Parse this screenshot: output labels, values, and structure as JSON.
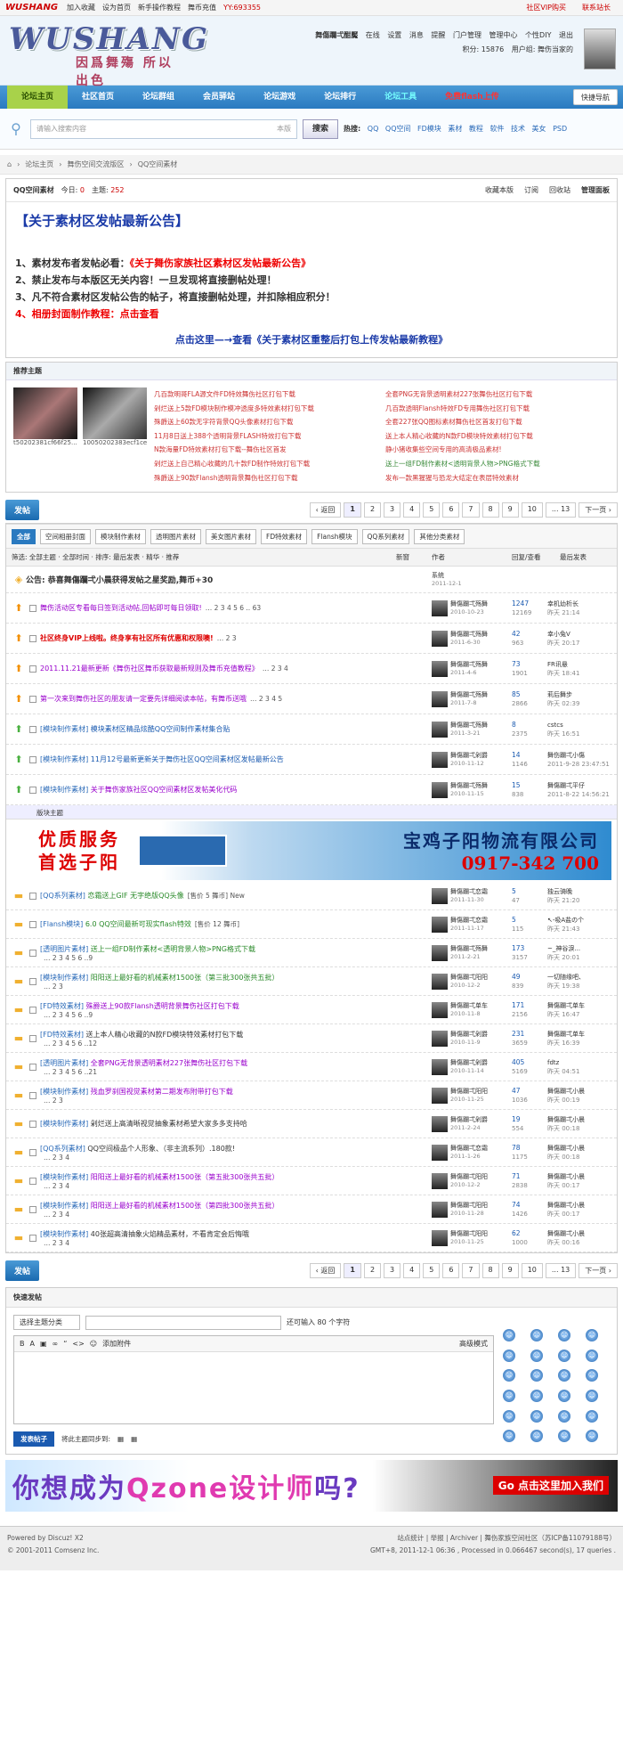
{
  "topbar": {
    "logo": "WUSHANG",
    "links": [
      "加入收藏",
      "设为首页",
      "新手操作教程",
      "舞币充值",
      "YY:693355"
    ],
    "right": [
      "社区VIP购买",
      "联系站长"
    ]
  },
  "header": {
    "brand": "WUSHANG",
    "slogan": "因爲舞殤 所以出色",
    "user_name": "舞傷躝弌酣魘",
    "user_links": [
      "在线",
      "设置",
      "消息",
      "提醒",
      "门户管理",
      "管理中心",
      "个性DIY",
      "退出"
    ],
    "credit": "积分: 15876",
    "usergroup": "用户组: 舞伤当家的"
  },
  "nav": {
    "items": [
      "论坛主页",
      "社区首页",
      "论坛群组",
      "会员驿站",
      "论坛游戏",
      "论坛排行",
      "论坛工具",
      "免费flash上传"
    ],
    "quick": "快捷导航"
  },
  "search": {
    "placeholder": "请输入搜索内容",
    "scope": "本版",
    "button": "搜索",
    "hot_label": "热搜:",
    "hot": [
      "QQ",
      "QQ空间",
      "FD模块",
      "素材",
      "教程",
      "软件",
      "技术",
      "美女",
      "PSD"
    ]
  },
  "crumb": [
    "论坛主页",
    "舞伤空间交流版区",
    "QQ空间素材"
  ],
  "forum": {
    "name": "QQ空间素材",
    "today_label": "今日:",
    "today": "0",
    "topics_label": "主题:",
    "topics": "252",
    "ops": [
      "收藏本版",
      "订阅",
      "回收站",
      "管理面板"
    ]
  },
  "announce": {
    "title": "【关于素材区发帖最新公告】",
    "l1a": "1、素材发布者发帖必看：",
    "l1b": "《关于舞伤家族社区素材区发帖最新公告》",
    "l2": "2、禁止发布与本版区无关内容！一旦发现将直接删帖处理！",
    "l3": "3、凡不符合素材区发帖公告的帖子，将直接删帖处理，并扣除相应积分！",
    "l4a": "4、相册封面制作教程：",
    "l4b": "点击查看",
    "link": "点击这里—→查看《关于素材区重整后打包上传发帖最新教程》"
  },
  "hot": {
    "title": "推荐主题",
    "captions": [
      "t50202381cf66f25...",
      "10050202383ecf1ce"
    ],
    "col1": [
      "几百款明哥FLA源文件FD特效舞伤社区打包下载",
      "剁烂送上5款FD模块制作模冲透度多特效素材打包下载",
      "殊爵送上60款无字符背景QQ头像素材打包下载",
      "11月8日送上388个透明背景FLASH特效打包下载",
      "N款海量FD特效素材打包下载--舞伤社区首发",
      "剁烂送上自己精心收藏的几十款FD制作特效打包下载",
      "殊爵送上90款Flansh透明背景舞伤社区打包下载"
    ],
    "col2": [
      "全套PNG无背景透明素材227张舞伤社区打包下载",
      "几百款透明Flansh特效FD专用舞伤社区打包下载",
      "全套227张QQ图标素材舞伤社区首发打包下载",
      "送上本人精心收藏的N款FD模块特效素材打包下载",
      "静小猪收集些空间专用的高清极品素材!",
      "送上一组FD制作素材<透明背景人物>PNG格式下载",
      "发布一款黑猩猩与恐龙大结定在表层特效素材"
    ]
  },
  "pager": {
    "post": "发帖",
    "prev": "返回",
    "pages": [
      "1",
      "2",
      "3",
      "4",
      "5",
      "6",
      "7",
      "8",
      "9",
      "10",
      "... 13"
    ],
    "next": "下一页"
  },
  "types": [
    "全部",
    "空间相册封面",
    "模块制作素材",
    "透明图片素材",
    "美女图片素材",
    "FD特效素材",
    "Flansh模块",
    "QQ系列素材",
    "其他分类素材"
  ],
  "filter": {
    "left": "筛选: 全部主题 · 全部时间 · 排序: 最后发表 · 精华 · 推荐",
    "new": "新窗",
    "author": "作者",
    "replies": "回复/查看",
    "last": "最后发表"
  },
  "threads_top": [
    {
      "ic": "sys",
      "subj": "公告: 恭喜舞傷躝弌小晨获得发帖之星奖励,舞币+30",
      "cls": "",
      "author": "系统",
      "date": "2011-12-1",
      "r": "",
      "v": "",
      "la": "",
      "ld": ""
    },
    {
      "ic": "up",
      "subj": "舞伤活动区专看每日签到活动帖,回帖即可每日领取!",
      "pages": "2 3 4 5 6 .. 63",
      "cls": "purple",
      "author": "舞傷躝弌殇舞",
      "date": "2010-10-23",
      "r": "1247",
      "v": "12169",
      "la": "幸机幼析长",
      "ld": "昨天 21:14"
    },
    {
      "ic": "up",
      "subj": "社区终身VIP上线啦。终身享有社区所有优惠和权限噢!",
      "pages": "2 3",
      "cls": "red",
      "author": "舞傷躝弌殇舞",
      "date": "2011-6-30",
      "r": "42",
      "v": "963",
      "la": "幸小兔V",
      "ld": "昨天 20:17"
    },
    {
      "ic": "up",
      "subj": "2011.11.21最新更新《舞伤社区舞币获取最新规则及舞币充值教程》",
      "pages": "2 3 4",
      "cls": "purple",
      "author": "舞傷躝弌殇舞",
      "date": "2011-4-6",
      "r": "73",
      "v": "1901",
      "la": "FR讯悬",
      "ld": "昨天 18:41"
    },
    {
      "ic": "up",
      "subj": "第一次来到舞伤社区的朋友请一定要先详细阅读本帖，有舞币送哦",
      "pages": "2 3 4 5",
      "cls": "purple",
      "author": "舞傷躝弌殇舞",
      "date": "2011-7-8",
      "r": "85",
      "v": "2866",
      "la": "莉后舞步",
      "ld": "昨天 02:39"
    },
    {
      "ic": "gr",
      "type": "[模块制作素材]",
      "subj": "模块素材区精品炫酷QQ空间制作素材集合贴",
      "cls": "blue",
      "author": "舞傷躝弌殇舞",
      "date": "2011-3-21",
      "r": "8",
      "v": "2375",
      "la": "cstcs",
      "ld": "昨天 16:51"
    },
    {
      "ic": "gr",
      "type": "[模块制作素材]",
      "subj": "11月12号最新更新关于舞伤社区QQ空间素材区发帖最新公告",
      "cls": "blue",
      "author": "舞傷躝弌剁爵",
      "date": "2010-11-12",
      "r": "14",
      "v": "1146",
      "la": "舞伤躝弌小傷",
      "ld": "2011-9-28 23:47:51"
    },
    {
      "ic": "gr",
      "type": "[模块制作素材]",
      "subj": "关于舞伤家族社区QQ空间素材区发帖美化代码",
      "cls": "purple",
      "author": "舞傷躝弌殇舞",
      "date": "2010-11-15",
      "r": "15",
      "v": "838",
      "la": "舞傷躝弌平仔",
      "ld": "2011-8-22 14:56:21"
    }
  ],
  "sep": "版块主题",
  "banner1": {
    "l1": "优质服务",
    "l2": "首选子阳",
    "company": "宝鸡子阳物流有限公司",
    "phone": "0917-342 700"
  },
  "threads": [
    {
      "type": "[QQ系列素材]",
      "subj": "恋霜送上GIF 无字绝版QQ头像",
      "extra": "[售价 5 舞币] New",
      "cls": "green",
      "author": "舞傷躝弌恋霜",
      "date": "2011-11-30",
      "r": "5",
      "v": "47",
      "la": "独云骑晚",
      "ld": "昨天 21:20"
    },
    {
      "type": "[Flansh模块]",
      "subj": "6.0 QQ空间最新可现实flash特效",
      "extra": "[售价 12 舞币]",
      "cls": "green",
      "author": "舞傷躝弌恋霜",
      "date": "2011-11-17",
      "r": "5",
      "v": "115",
      "la": "↖-吸A盐の个",
      "ld": "昨天 21:43"
    },
    {
      "type": "[透明图片素材]",
      "subj": "送上一组FD制作素材<透明背景人物>PNG格式下载",
      "pages": "2 3 4 5 6 ..9",
      "cls": "green",
      "author": "舞傷躝弌殇舞",
      "date": "2011-2-21",
      "r": "173",
      "v": "3157",
      "la": "~_神谷淚...",
      "ld": "昨天 20:01"
    },
    {
      "type": "[模块制作素材]",
      "subj": "阳阳送上最好看的机械素材1500张（第三批300张共五批）",
      "pages": "2 3",
      "cls": "green",
      "author": "舞傷躝弌阳阳",
      "date": "2010-12-2",
      "r": "49",
      "v": "839",
      "la": "一切随缘吧、",
      "ld": "昨天 19:38"
    },
    {
      "type": "[FD特效素材]",
      "subj": "殊爵送上90款Flansh透明背景舞伤社区打包下载",
      "pages": "2 3 4 5 6 ..9",
      "cls": "purple",
      "author": "舞傷躝弌单车",
      "date": "2010-11-8",
      "r": "171",
      "v": "2156",
      "la": "舞傷躝弌单车",
      "ld": "昨天 16:47"
    },
    {
      "type": "[FD特效素材]",
      "subj": "送上本人精心收藏的N款FD模块特效素材打包下载",
      "pages": "2 3 4 5 6 ..12",
      "cls": "",
      "author": "舞傷躝弌剁爵",
      "date": "2010-11-9",
      "r": "231",
      "v": "3659",
      "la": "舞傷躝弌单车",
      "ld": "昨天 16:39"
    },
    {
      "type": "[透明图片素材]",
      "subj": "全套PNG无背景透明素材227张舞伤社区打包下载",
      "pages": "2 3 4 5 6 ..21",
      "cls": "purple",
      "author": "舞傷躝弌剁爵",
      "date": "2010-11-14",
      "r": "405",
      "v": "5169",
      "la": "fdtz",
      "ld": "昨天 04:51"
    },
    {
      "type": "[模块制作素材]",
      "subj": "残血罗刹国视觉素材第二期发布附带打包下载",
      "pages": "2 3",
      "cls": "purple",
      "author": "舞傷躝弌阳阳",
      "date": "2010-11-25",
      "r": "47",
      "v": "1036",
      "la": "舞傷躝弌小晨",
      "ld": "昨天 00:19"
    },
    {
      "type": "[模块制作素材]",
      "subj": "剁烂送上高清晰视觉抽象素材希望大家多多支持哈",
      "cls": "",
      "author": "舞傷躝弌剁爵",
      "date": "2011-2-24",
      "r": "19",
      "v": "554",
      "la": "舞傷躝弌小晨",
      "ld": "昨天 00:18"
    },
    {
      "type": "[QQ系列素材]",
      "subj": "QQ空间极品个人形象、（非主流系列）.180款!",
      "pages": "2 3 4",
      "cls": "",
      "author": "舞傷躝弌恋霜",
      "date": "2011-1-26",
      "r": "78",
      "v": "1175",
      "la": "舞傷躝弌小晨",
      "ld": "昨天 00:18"
    },
    {
      "type": "[模块制作素材]",
      "subj": "阳阳送上最好看的机械素材1500张（第五批300张共五批）",
      "pages": "2 3 4",
      "cls": "purple",
      "author": "舞傷躝弌阳阳",
      "date": "2010-12-2",
      "r": "71",
      "v": "2838",
      "la": "舞傷躝弌小晨",
      "ld": "昨天 00:17"
    },
    {
      "type": "[模块制作素材]",
      "subj": "阳阳送上最好看的机械素材1500张（第四批300张共五批）",
      "pages": "2 3 4",
      "cls": "purple",
      "author": "舞傷躝弌阳阳",
      "date": "2010-11-28",
      "r": "74",
      "v": "1426",
      "la": "舞傷躝弌小晨",
      "ld": "昨天 00:17"
    },
    {
      "type": "[模块制作素材]",
      "subj": "40张超高清抽象火焰精品素材，不看肯定会后悔哦",
      "pages": "2 3 4",
      "cls": "",
      "author": "舞傷躝弌阳阳",
      "date": "2010-11-25",
      "r": "62",
      "v": "1000",
      "la": "舞傷躝弌小晨",
      "ld": "昨天 00:16"
    }
  ],
  "quick": {
    "title": "快速发帖",
    "sel": "选择主题分类",
    "remain": "还可输入 80 个字符",
    "attach": "添加附件",
    "mode": "高级模式",
    "submit": "发表帖子",
    "sync": "将此主题同步到:"
  },
  "banner2": {
    "big1": "你想成为",
    "big2": "Qzone设计师",
    "big3": "吗?",
    "go": "Go 点击这里加入我们"
  },
  "footer": {
    "powered": "Powered by Discuz! X2",
    "copy": "© 2001-2011 Comsenz Inc.",
    "links": "站点统计 | 举报 | Archiver | 舞伤家族空间社区（苏ICP备11079188号）",
    "gmt": "GMT+8, 2011-12-1 06:36 , Processed in 0.066467 second(s), 17 queries ."
  }
}
